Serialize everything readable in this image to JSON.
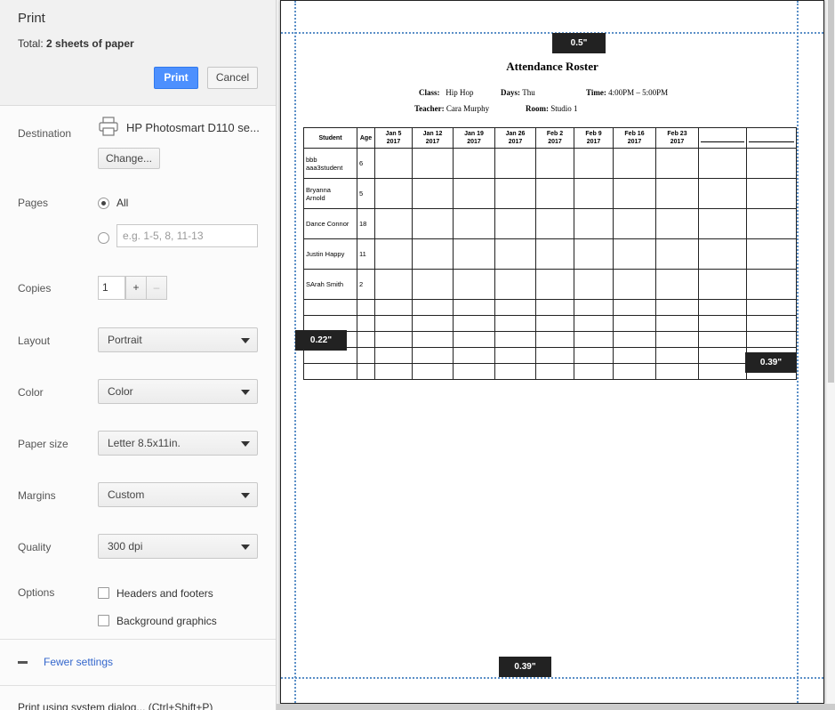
{
  "header": {
    "title": "Print",
    "total_prefix": "Total: ",
    "total_value": "2 sheets of paper",
    "print_label": "Print",
    "cancel_label": "Cancel"
  },
  "destination": {
    "label": "Destination",
    "printer": "HP Photosmart D110 se...",
    "change_label": "Change..."
  },
  "pages": {
    "label": "Pages",
    "all_label": "All",
    "range_placeholder": "e.g. 1-5, 8, 11-13"
  },
  "copies": {
    "label": "Copies",
    "value": "1",
    "plus": "+",
    "minus": "–"
  },
  "layout": {
    "label": "Layout",
    "value": "Portrait"
  },
  "color": {
    "label": "Color",
    "value": "Color"
  },
  "paper_size": {
    "label": "Paper size",
    "value": "Letter 8.5x11in."
  },
  "margins": {
    "label": "Margins",
    "value": "Custom"
  },
  "quality": {
    "label": "Quality",
    "value": "300 dpi"
  },
  "options": {
    "label": "Options",
    "headers_footers": "Headers and footers",
    "background_graphics": "Background graphics"
  },
  "fewer_settings": "Fewer settings",
  "system_dialog": "Print using system dialog... (Ctrl+Shift+P)",
  "margin_labels": {
    "top": "0.5\"",
    "left": "0.22\"",
    "right": "0.39\"",
    "bottom": "0.39\""
  },
  "roster": {
    "title": "Attendance Roster",
    "class_label": "Class:",
    "class_value": "Hip Hop",
    "days_label": "Days:",
    "days_value": "Thu",
    "time_label": "Time:",
    "time_value": "4:00PM – 5:00PM",
    "teacher_label": "Teacher:",
    "teacher_value": "Cara Murphy",
    "room_label": "Room:",
    "room_value": "Studio 1",
    "columns": {
      "student": "Student",
      "age": "Age",
      "dates": [
        [
          "Jan 5",
          "2017"
        ],
        [
          "Jan 12",
          "2017"
        ],
        [
          "Jan 19",
          "2017"
        ],
        [
          "Jan 26",
          "2017"
        ],
        [
          "Feb 2",
          "2017"
        ],
        [
          "Feb 9",
          "2017"
        ],
        [
          "Feb 16",
          "2017"
        ],
        [
          "Feb 23",
          "2017"
        ]
      ]
    },
    "students": [
      {
        "name_lines": [
          "bbb",
          "aaa3student"
        ],
        "age": "6"
      },
      {
        "name_lines": [
          "Bryanna",
          "Arnold"
        ],
        "age": "5"
      },
      {
        "name_lines": [
          "Dance Connor"
        ],
        "age": "18"
      },
      {
        "name_lines": [
          "Justin Happy"
        ],
        "age": "11"
      },
      {
        "name_lines": [
          "SArah Smith"
        ],
        "age": "2"
      }
    ]
  }
}
